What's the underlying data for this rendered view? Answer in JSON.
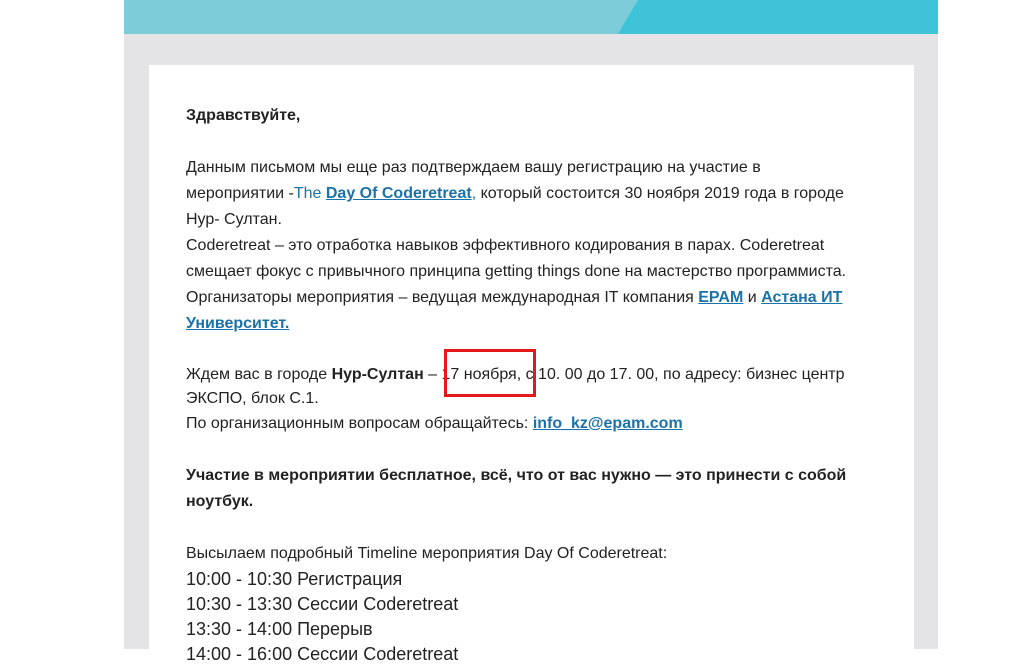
{
  "email": {
    "greeting": "Здравствуйте,",
    "p1": {
      "line1": "Данным письмом мы еще раз подтверждаем вашу регистрацию на участие в",
      "line2_pre": "мероприятии -",
      "line2_the": "The ",
      "event_link": "Day Of Coderetreat",
      "line2_comma": ",",
      "line2_post": " который состоится 30 ноября 2019 года в городе",
      "line3": "Нур- Султан.",
      "line4": "Coderetreat – это отработка навыков эффективного кодирования в парах. Coderetreat",
      "line5": "смещает фокус с привычного принципа getting things done на мастерство программиста.",
      "line6_pre": "Организаторы мероприятия – ведущая международная IT компания ",
      "epam_link": "EPAM",
      "line6_and": " и ",
      "astana_link_1": "Астана ИТ",
      "astana_link_2": "Университет."
    },
    "p2": {
      "line1_pre": "Ждем вас в городе ",
      "city": "Нур-Султан",
      "line1_dash": " – ",
      "date": "17 ноября",
      "line1_post": ", с 10. 00 до 17. 00, по адресу: бизнес центр",
      "line2": "ЭКСПО, блок С.1.",
      "line3_pre": "По организационным вопросам обращайтесь: ",
      "email_link": "info_kz@epam.com"
    },
    "p3": {
      "line1": "Участие в мероприятии бесплатное, всё, что от вас нужно — это принести с собой",
      "line2": "ноутбук."
    },
    "timeline": {
      "intro": "Высылаем подробный Timeline мероприятия Day Of Coderetreat:",
      "items": [
        "10:00 - 10:30 Регистрация",
        "10:30 - 13:30 Сессии Coderetreat",
        "13:30 - 14:00 Перерыв",
        "14:00 - 16:00 Сессии Coderetreat"
      ]
    }
  },
  "colors": {
    "banner": "#7ccdd9",
    "banner_accent": "#3fc3d8",
    "link": "#1b72a8",
    "highlight": "#e21a1a"
  }
}
